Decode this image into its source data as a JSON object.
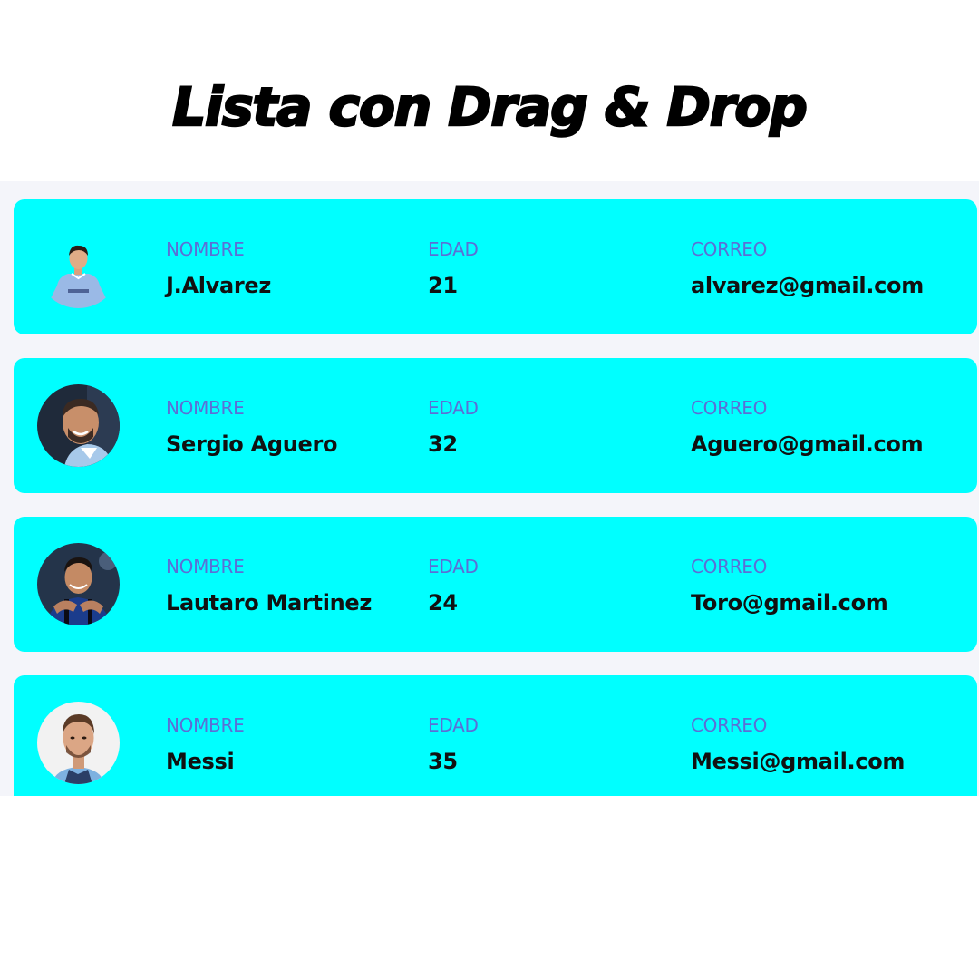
{
  "title": "Lista con Drag & Drop",
  "labels": {
    "name": "NOMBRE",
    "age": "EDAD",
    "email": "CORREO"
  },
  "players": [
    {
      "name": "J.Alvarez",
      "age": "21",
      "email": "alvarez@gmail.com",
      "avatar_icon": "player-photo-alvarez"
    },
    {
      "name": "Sergio Aguero",
      "age": "32",
      "email": "Aguero@gmail.com",
      "avatar_icon": "player-photo-aguero"
    },
    {
      "name": "Lautaro Martinez",
      "age": "24",
      "email": "Toro@gmail.com",
      "avatar_icon": "player-photo-martinez"
    },
    {
      "name": "Messi",
      "age": "35",
      "email": "Messi@gmail.com",
      "avatar_icon": "player-photo-messi"
    }
  ],
  "colors": {
    "card": "#00ffff",
    "label": "#5b6fd6",
    "value": "#111111",
    "panel": "#f4f5fa"
  }
}
